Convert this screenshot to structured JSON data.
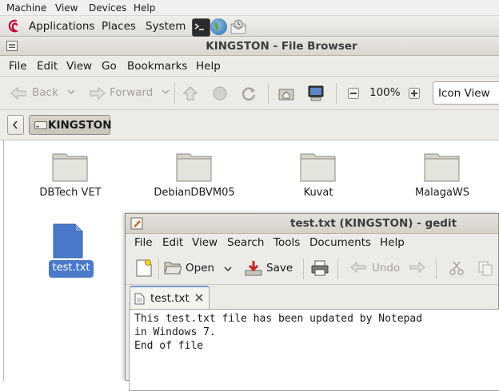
{
  "vm_menu": [
    "Machine",
    "View",
    "Devices",
    "Help"
  ],
  "panel": {
    "applications": "Applications",
    "places": "Places",
    "system": "System"
  },
  "file_browser": {
    "title": "KINGSTON - File Browser",
    "menu": [
      "File",
      "Edit",
      "View",
      "Go",
      "Bookmarks",
      "Help"
    ],
    "toolbar": {
      "back": "Back",
      "forward": "Forward",
      "zoom": "100%",
      "view_mode": "Icon View"
    },
    "location": {
      "path_button": "KINGSTON"
    },
    "items": [
      {
        "name": "DBTech VET",
        "type": "folder"
      },
      {
        "name": "DebianDBVM05",
        "type": "folder"
      },
      {
        "name": "Kuvat",
        "type": "folder"
      },
      {
        "name": "MalagaWS",
        "type": "folder"
      },
      {
        "name": "test.txt",
        "type": "file",
        "selected": true
      }
    ]
  },
  "gedit": {
    "title": "test.txt (KINGSTON) - gedit",
    "menu": [
      "File",
      "Edit",
      "View",
      "Search",
      "Tools",
      "Documents",
      "Help"
    ],
    "toolbar": {
      "open": "Open",
      "save": "Save",
      "undo": "Undo"
    },
    "tab_label": "test.txt",
    "content": "This test.txt file has been updated by Notepad\nin Windows 7.\nEnd of file"
  },
  "colors": {
    "selection": "#4a79c9",
    "folder": "#d8d6cc",
    "panel": "#e9e7e2"
  }
}
